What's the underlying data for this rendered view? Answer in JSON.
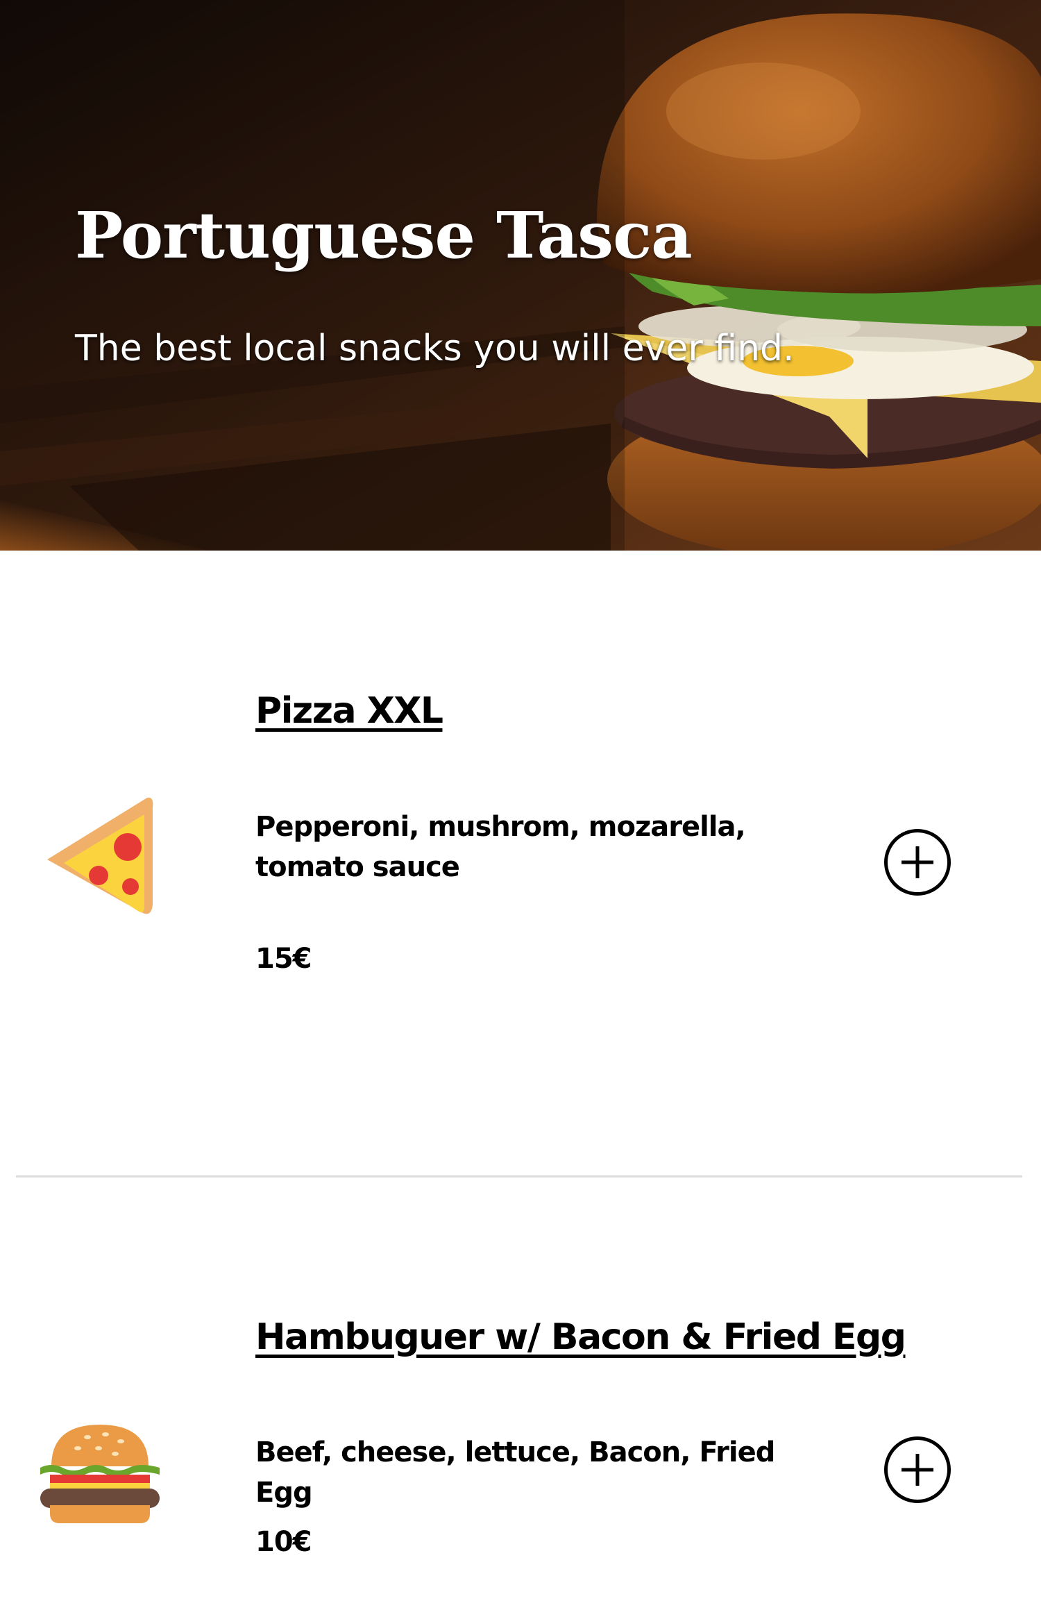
{
  "hero": {
    "title": "Portuguese Tasca",
    "subtitle": "The best local snacks you will ever find."
  },
  "menu": {
    "items": [
      {
        "name": "Pizza XXL",
        "description": "Pepperoni, mushrom, mozarella, tomato sauce",
        "price": "15€",
        "icon": "pizza-slice-icon",
        "add_icon": "plus-circle-icon"
      },
      {
        "name": "Hambuguer w/ Bacon & Fried Egg",
        "description": "Beef, cheese, lettuce, Bacon, Fried Egg",
        "price": "10€",
        "icon": "hamburger-icon",
        "add_icon": "plus-circle-icon"
      }
    ]
  },
  "colors": {
    "text": "#000000",
    "hero_text": "#ffffff",
    "divider": "#dcdcdc",
    "pizza_crust": "#f0b06a",
    "pizza_cheese": "#fbd33f",
    "pepperoni": "#e53935",
    "bun": "#eb9b45",
    "lettuce": "#6aa62c",
    "patty": "#6b4a3c"
  }
}
